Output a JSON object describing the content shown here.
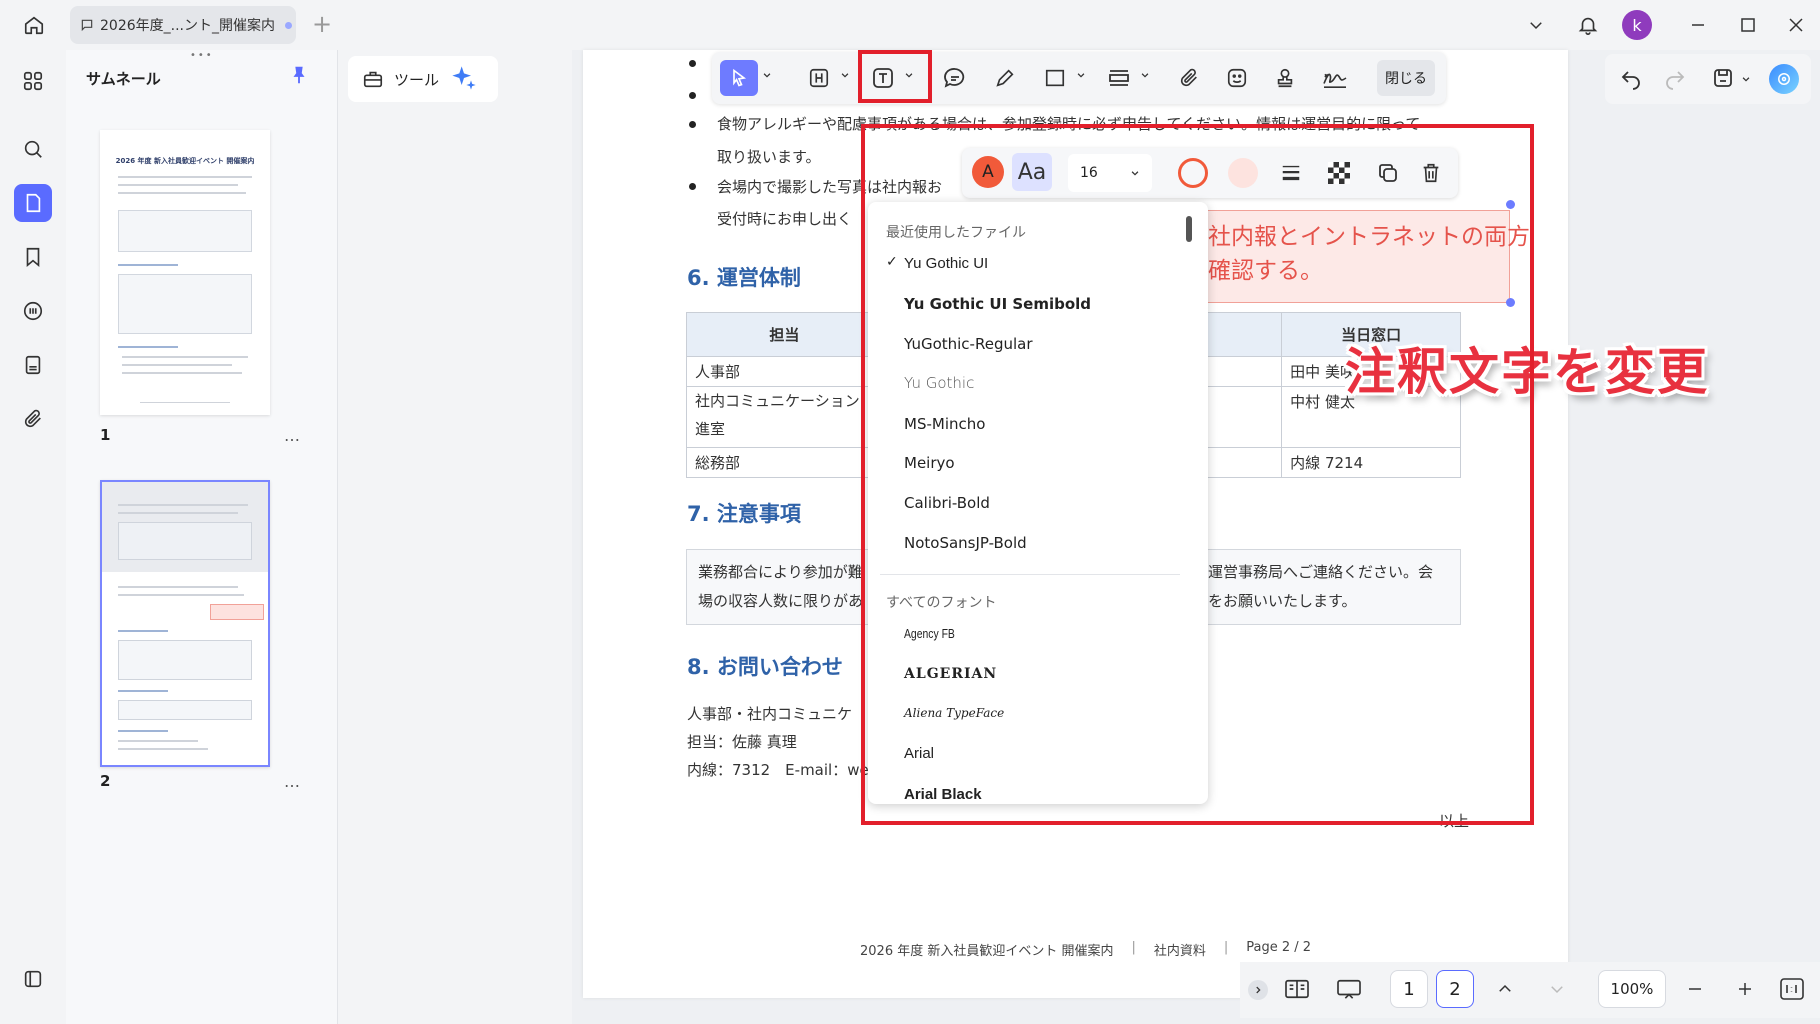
{
  "titlebar": {
    "doc_tab_title": "2026年度_...ント_開催案内",
    "add_tab": "+"
  },
  "user": {
    "avatar_initial": "k"
  },
  "thumbnails": {
    "title": "サムネール",
    "pages": [
      {
        "number": "1",
        "thumb_title": "2026 年度 新入社員歓迎イベント 開催案内"
      },
      {
        "number": "2"
      }
    ],
    "more": "…"
  },
  "tools": {
    "label": "ツール"
  },
  "annot_toolbar": {
    "close_label": "閉じる"
  },
  "prop_toolbar": {
    "font_size": "16",
    "font_sample": "Aa",
    "font_color_glyph": "A"
  },
  "font_menu": {
    "recent_header": "最近使用したファイル",
    "recent": [
      {
        "name": "Yu Gothic UI",
        "checked": "✓"
      },
      {
        "name": "Yu Gothic UI Semibold"
      },
      {
        "name": "YuGothic-Regular"
      },
      {
        "name": "Yu Gothic"
      },
      {
        "name": "MS-Mincho"
      },
      {
        "name": "Meiryo"
      },
      {
        "name": "Calibri-Bold"
      },
      {
        "name": "NotoSansJP-Bold"
      }
    ],
    "all_header": "すべてのフォント",
    "all": [
      {
        "name": "Agency FB"
      },
      {
        "name": "ALGERIAN"
      },
      {
        "name": "Aliena TypeFace"
      },
      {
        "name": "Arial"
      },
      {
        "name": "Arial Black"
      }
    ]
  },
  "document": {
    "bullets": [
      "食物アレルギーや配慮事項がある場合は、参加登録時に必ず申告してください。情報は運営目的に限って",
      "取り扱います。",
      "会場内で撮影した写真は社内報お",
      "受付時にお申し出く"
    ],
    "annotation": [
      "社内報とイントラネットの両方",
      "確認する。"
    ],
    "sec6_title": "6. 運営体制",
    "table": {
      "headers": [
        "担当",
        "当日窓口"
      ],
      "rows": [
        [
          "人事部",
          "田中 美咲"
        ],
        [
          "社内コミュニケーション",
          "中村 健太"
        ],
        [
          "進室",
          ""
        ],
        [
          "総務部",
          "内線 7214"
        ]
      ]
    },
    "sec7_title": "7. 注意事項",
    "notice": [
      "業務都合により参加が難",
      "運営事務局へご連絡ください。会",
      "場の収容人数に限りがあ",
      "をお願いいたします。"
    ],
    "sec8_title": "8. お問い合わせ",
    "contact": [
      "人事部・社内コミュニケ",
      "担当：佐藤 真理",
      "内線：7312　E-mail：we"
    ],
    "closing": "以上",
    "footer": [
      "2026 年度 新入社員歓迎イベント 開催案内",
      "|",
      "社内資料",
      "|",
      "Page 2 / 2"
    ]
  },
  "callout": "注釈文字を変更",
  "bottombar": {
    "page1": "1",
    "page2": "2",
    "zoom": "100%"
  },
  "colors": {
    "accent": "#5a6bff",
    "highlight": "#e21f2b",
    "heading": "#2f62a8",
    "annot_text": "#e5534b"
  }
}
